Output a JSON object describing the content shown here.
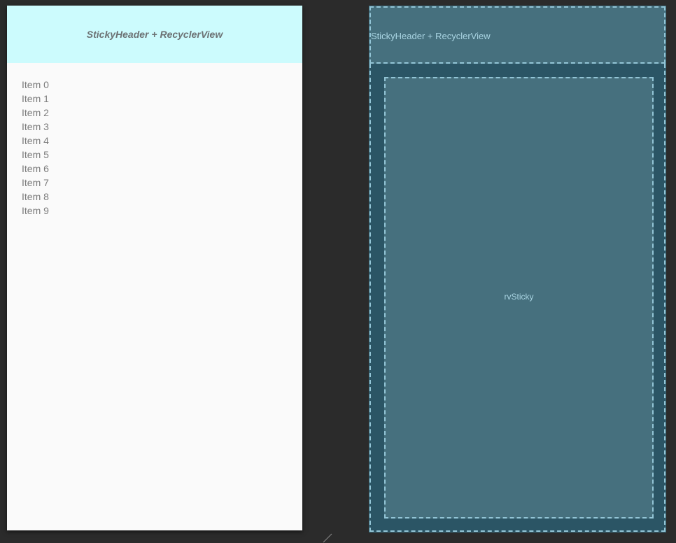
{
  "design": {
    "header_title": "StickyHeader + RecyclerView",
    "items": [
      "Item 0",
      "Item 1",
      "Item 2",
      "Item 3",
      "Item 4",
      "Item 5",
      "Item 6",
      "Item 7",
      "Item 8",
      "Item 9"
    ]
  },
  "blueprint": {
    "header_label": "StickyHeader + RecyclerView",
    "recycler_label": "rvSticky"
  },
  "colors": {
    "editor_background": "#2b2b2b",
    "design_header_bg": "#ccfbfd",
    "design_body_bg": "#fafafa",
    "blueprint_bg": "#2b5565",
    "blueprint_view_fill": "#46707e",
    "blueprint_outline": "#93c5d6"
  },
  "icons": {
    "resize_handle": "resize-handle-icon"
  }
}
